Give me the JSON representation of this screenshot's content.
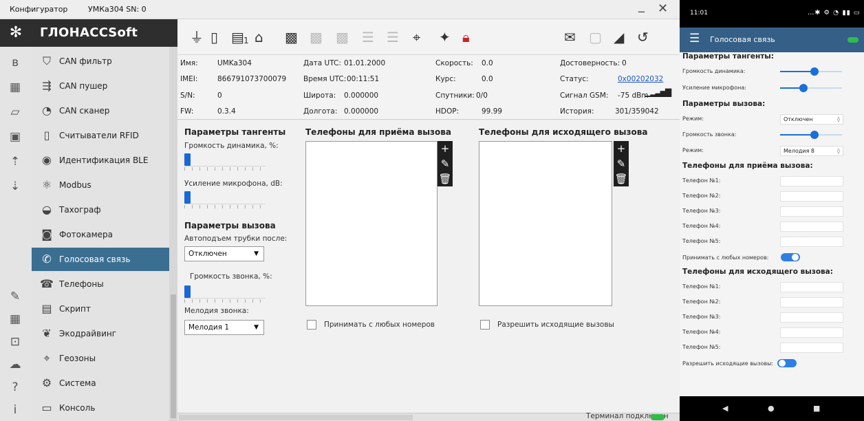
{
  "window": {
    "app_name": "Конфигуратор",
    "device": "УМКа304 SN: 0",
    "minimize": "_",
    "close": "✕"
  },
  "brand": "ГЛОНАССSoft",
  "sidebar": {
    "items": [
      {
        "label": "CAN фильтр",
        "icon": "can-filter-icon",
        "glyph": "⛉"
      },
      {
        "label": "CAN пушер",
        "icon": "can-pusher-icon",
        "glyph": "⇶"
      },
      {
        "label": "CAN сканер",
        "icon": "can-scanner-icon",
        "glyph": "◔"
      },
      {
        "label": "Считыватели RFID",
        "icon": "rfid-icon",
        "glyph": "▯"
      },
      {
        "label": "Идентификация BLE",
        "icon": "ble-icon",
        "glyph": "◉"
      },
      {
        "label": "Modbus",
        "icon": "modbus-icon",
        "glyph": "⚛"
      },
      {
        "label": "Тахограф",
        "icon": "tachograph-icon",
        "glyph": "◒"
      },
      {
        "label": "Фотокамера",
        "icon": "camera-icon",
        "glyph": "◙"
      },
      {
        "label": "Голосовая связь",
        "icon": "voice-call-icon",
        "glyph": "✆",
        "active": true
      },
      {
        "label": "Телефоны",
        "icon": "phones-icon",
        "glyph": "☎"
      },
      {
        "label": "Скрипт",
        "icon": "script-icon",
        "glyph": "▤"
      },
      {
        "label": "Экодрайвинг",
        "icon": "ecodriving-icon",
        "glyph": "❦"
      },
      {
        "label": "Геозоны",
        "icon": "geozones-icon",
        "glyph": "⌖"
      },
      {
        "label": "Система",
        "icon": "system-icon",
        "glyph": "⚙"
      },
      {
        "label": "Консоль",
        "icon": "console-icon",
        "glyph": "▭"
      }
    ]
  },
  "iconbar": {
    "top": [
      {
        "name": "bluetooth-icon",
        "glyph": "ʙ"
      },
      {
        "name": "sim-card-icon",
        "glyph": "▦"
      },
      {
        "name": "folder-icon",
        "glyph": "▱"
      },
      {
        "name": "save-icon",
        "glyph": "▣"
      },
      {
        "name": "upload-icon",
        "glyph": "⇡"
      },
      {
        "name": "download-icon",
        "glyph": "⇣"
      }
    ],
    "bottom": [
      {
        "name": "edit-icon",
        "glyph": "✎"
      },
      {
        "name": "calculator-icon",
        "glyph": "▦"
      },
      {
        "name": "can-icon",
        "glyph": "⊡"
      },
      {
        "name": "cloud-icon",
        "glyph": "☁"
      },
      {
        "name": "help-icon",
        "glyph": "?"
      },
      {
        "name": "info-icon",
        "glyph": "i"
      }
    ]
  },
  "toolbar": {
    "sim_number": "1",
    "icons": [
      {
        "name": "power-plug-icon",
        "glyph": "⏚",
        "state": "on"
      },
      {
        "name": "battery-icon",
        "glyph": "▯",
        "state": "on"
      },
      {
        "name": "sim-slot-icon",
        "glyph": "▤",
        "state": "on"
      },
      {
        "name": "home-antenna-icon",
        "glyph": "⌂",
        "state": "on"
      },
      {
        "name": "gsm-module-icon",
        "glyph": "▩",
        "state": "on"
      },
      {
        "name": "module-2-icon",
        "glyph": "▩",
        "state": "dim"
      },
      {
        "name": "module-3-icon",
        "glyph": "▩",
        "state": "dim"
      },
      {
        "name": "database-icon",
        "glyph": "☰",
        "state": "dim"
      },
      {
        "name": "database-settings-icon",
        "glyph": "☰",
        "state": "dim"
      },
      {
        "name": "gps-off-icon",
        "glyph": "⌖",
        "state": "on"
      },
      {
        "name": "satellite-icon",
        "glyph": "✦",
        "state": "on"
      },
      {
        "name": "lock-alert-icon",
        "glyph": "🔒︎",
        "state": "red"
      },
      {
        "name": "mail-icon",
        "glyph": "✉",
        "state": "on"
      },
      {
        "name": "document-icon",
        "glyph": "▢",
        "state": "dim"
      },
      {
        "name": "satellite-dish-icon",
        "glyph": "◢",
        "state": "on"
      },
      {
        "name": "history-icon",
        "glyph": "↺",
        "state": "on"
      }
    ]
  },
  "info": {
    "name_label": "Имя:",
    "name_value": "UMKa304",
    "imei_label": "IMEI:",
    "imei_value": "866791073700079",
    "sn_label": "S/N:",
    "sn_value": "0",
    "fw_label": "FW:",
    "fw_value": "0.3.4",
    "date_label": "Дата UTC:",
    "date_value": "01.01.2000",
    "time_label": "Время UTC:",
    "time_value": "00:11:51",
    "lat_label": "Широта:",
    "lat_value": "0.000000",
    "lon_label": "Долгота:",
    "lon_value": "0.000000",
    "speed_label": "Скорость:",
    "speed_value": "0.0",
    "course_label": "Курс:",
    "course_value": "0.0",
    "sats_label": "Спутники:",
    "sats_value": "0/0",
    "hdop_label": "HDOP:",
    "hdop_value": "99.99",
    "valid_label": "Достоверность:",
    "valid_value": "0",
    "status_label": "Статус:",
    "status_value": "0x00202032",
    "gsm_label": "Сигнал GSM:",
    "gsm_value": "-75 dBm",
    "history_label": "История:",
    "history_value": "301/359042"
  },
  "headset": {
    "title": "Параметры тангенты",
    "speaker_label": "Громкость динамика, %:",
    "speaker_level": 0,
    "mic_label": "Усиление микрофона, dB:",
    "mic_level": 0
  },
  "call": {
    "title": "Параметры вызова",
    "autoanswer_label": "Автоподъем трубки после:",
    "autoanswer_value": "Отключен",
    "ring_volume_label": "Громкость звонка, %:",
    "ring_level": 0,
    "melody_label": "Мелодия звонка:",
    "melody_value": "Мелодия 1"
  },
  "incoming": {
    "title": "Телефоны для приёма вызова",
    "checkbox_label": "Принимать с любых номеров",
    "checked": false
  },
  "outgoing": {
    "title": "Телефоны для исходящего вызова",
    "checkbox_label": "Разрешить исходящие вызовы",
    "checked": false
  },
  "list_tools": {
    "add": "+",
    "edit": "✎",
    "delete": "🗑︎"
  },
  "status": {
    "text": "Терминал подключен",
    "led_color": "#2fbd4a"
  },
  "phone": {
    "time": "11:01",
    "status_icons": "…✱ ⚙ ◔ ▮▮ ▭",
    "title": "Голосовая связь",
    "headset_title": "Параметры тангенты:",
    "speaker_label": "Громкость динамика:",
    "speaker_level": 0.55,
    "mic_label": "Усиление микрофона:",
    "mic_level": 0.38,
    "call_title": "Параметры вызова:",
    "mode_label": "Режим:",
    "mode_value": "Отключен",
    "ring_label": "Громкость звонка:",
    "ring_level": 0.55,
    "melody_label": "Режим:",
    "melody_value": "Мелодия 8",
    "incoming_title": "Телефоны для приёма вызова:",
    "incoming_phones": [
      "Телефон №1:",
      "Телефон №2:",
      "Телефон №3:",
      "Телефон №4:",
      "Телефон №5:"
    ],
    "accept_any_label": "Принимать с любых номеров:",
    "accept_any": true,
    "outgoing_title": "Телефоны для исходящего вызова:",
    "outgoing_phones": [
      "Телефон №1:",
      "Телефон №2:",
      "Телефон №3:",
      "Телефон №4:",
      "Телефон №5:"
    ],
    "allow_outgoing_label": "Разрешить исходящие вызовы:",
    "allow_outgoing": false,
    "nav": {
      "back": "◀",
      "home": "●",
      "recent": "■"
    }
  }
}
